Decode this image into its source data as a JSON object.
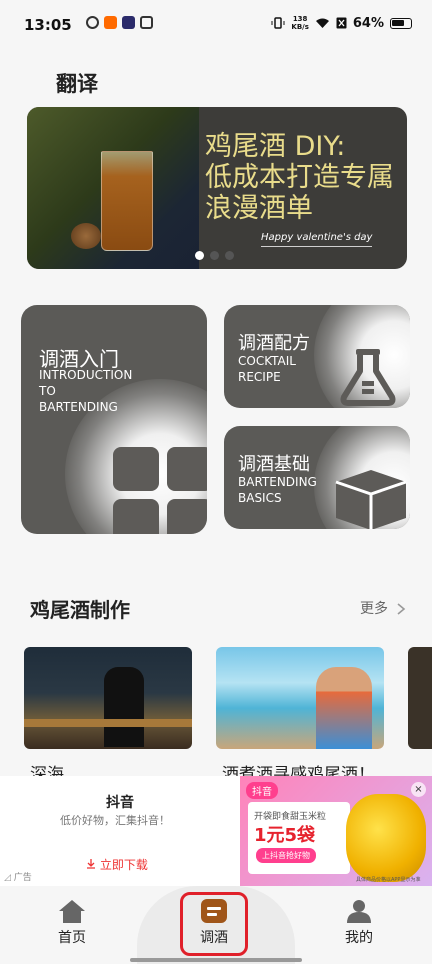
{
  "status_bar": {
    "time": "13:05",
    "speed_top": "138",
    "speed_unit": "KB/s",
    "battery": "64%"
  },
  "page": {
    "title": "翻译"
  },
  "banner": {
    "title_line1": "鸡尾酒 DIY:",
    "title_line2": "低成本打造专属",
    "title_line3": "浪漫酒单",
    "subtitle": "Happy valentine's day",
    "slides": 3,
    "active_slide": 1
  },
  "categories": [
    {
      "title": "调酒入门",
      "en_line1": "INTRODUCTION",
      "en_line2": "TO",
      "en_line3": "BARTENDING",
      "icon": "grid-icon"
    },
    {
      "title": "调酒配方",
      "en_line1": "COCKTAIL",
      "en_line2": "RECIPE",
      "icon": "flask-icon"
    },
    {
      "title": "调酒基础",
      "en_line1": "BARTENDING",
      "en_line2": "BASICS",
      "icon": "cube-icon"
    }
  ],
  "section": {
    "title": "鸡尾酒制作",
    "more": "更多",
    "items": [
      {
        "caption": "深海"
      },
      {
        "caption": "酒煮酒寻感鸡尾酒！"
      },
      {
        "caption": ""
      }
    ]
  },
  "ad": {
    "app_name": "抖音",
    "desc": "低价好物，汇集抖音！",
    "download": "立即下载",
    "tag": "广告",
    "image": {
      "brand": "抖音",
      "line1": "开袋即食甜玉米粒",
      "line2": "1元5袋",
      "line3": "上抖音抢好物",
      "footer": "具体商品价格以APP显示为准"
    },
    "close": "×"
  },
  "nav": {
    "items": [
      {
        "label": "首页",
        "icon": "home-icon"
      },
      {
        "label": "调酒",
        "icon": "cocktail-tab-icon",
        "active": true
      },
      {
        "label": "我的",
        "icon": "user-icon"
      }
    ]
  },
  "colors": {
    "accent": "#e0202a",
    "card": "#5b5a57",
    "banner_text": "#e9dc8b"
  }
}
